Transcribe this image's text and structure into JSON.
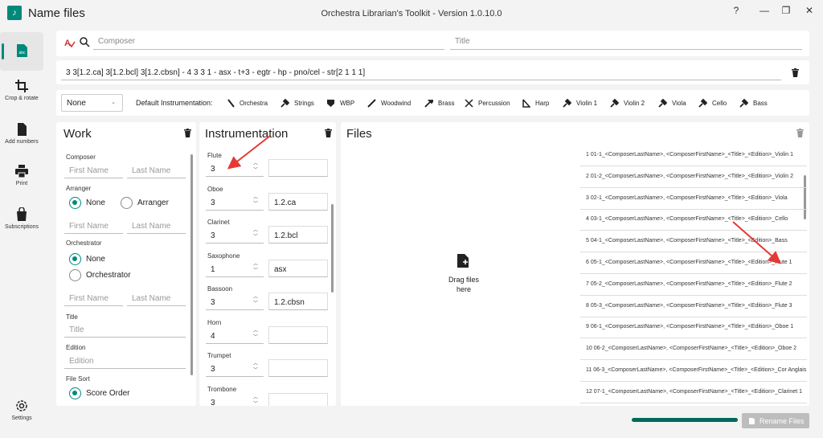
{
  "app": {
    "title": "Name files",
    "window_title": "Orchestra Librarian's Toolkit - Version 1.0.10.0",
    "controls": [
      "?",
      "—",
      "❐",
      "✕"
    ]
  },
  "sidebar": {
    "items": [
      {
        "label": "",
        "icon": "abc-icon"
      },
      {
        "label": "Crop & rotate",
        "icon": "crop-icon"
      },
      {
        "label": "Add numbers",
        "icon": "document-icon"
      },
      {
        "label": "Print",
        "icon": "printer-icon"
      },
      {
        "label": "Subscriptions",
        "icon": "bag-icon"
      }
    ],
    "settings_label": "Settings",
    "abc_text": "abc"
  },
  "search": {
    "composer_placeholder": "Composer",
    "title_placeholder": "Title"
  },
  "instr_string": "3 3[1.2.ca] 3[1.2.bcl] 3[1.2.cbsn] - 4 3 3 1 - asx - t+3 - egtr - hp - pno/cel - str[2 1 1 1]",
  "default_bar": {
    "dropdown": "None",
    "label": "Default Instrumentation:",
    "items": [
      "Orchestra",
      "Strings",
      "WBP",
      "Woodwind",
      "Brass",
      "Percussion",
      "Harp",
      "Violin 1",
      "Violin 2",
      "Viola",
      "Cello",
      "Bass"
    ]
  },
  "work": {
    "heading": "Work",
    "composer": "Composer",
    "first": "First Name",
    "last": "Last Name",
    "arranger": "Arranger",
    "none": "None",
    "arranger_opt": "Arranger",
    "orchestrator": "Orchestrator",
    "orch_opt": "Orchestrator",
    "title_label": "Title",
    "title_ph": "Title",
    "edition_label": "Edition",
    "edition_ph": "Edition",
    "file_sort": "File Sort",
    "score_order": "Score Order"
  },
  "instrumentation": {
    "heading": "Instrumentation",
    "rows": [
      {
        "name": "Flute",
        "count": "3",
        "extra": ""
      },
      {
        "name": "Oboe",
        "count": "3",
        "extra": "1.2.ca"
      },
      {
        "name": "Clarinet",
        "count": "3",
        "extra": "1.2.bcl"
      },
      {
        "name": "Saxophone",
        "count": "1",
        "extra": "asx"
      },
      {
        "name": "Bassoon",
        "count": "3",
        "extra": "1.2.cbsn"
      },
      {
        "name": "Horn",
        "count": "4",
        "extra": ""
      },
      {
        "name": "Trumpet",
        "count": "3",
        "extra": ""
      },
      {
        "name": "Trombone",
        "count": "3",
        "extra": ""
      }
    ]
  },
  "files": {
    "heading": "Files",
    "drag_line1": "Drag files",
    "drag_line2": "here",
    "list": [
      "1 01-1_<ComposerLastName>, <ComposerFirstName>_<Title>_<Edition>_Violin 1",
      "2 01-2_<ComposerLastName>, <ComposerFirstName>_<Title>_<Edition>_Violin 2",
      "3 02-1_<ComposerLastName>, <ComposerFirstName>_<Title>_<Edition>_Viola",
      "4 03-1_<ComposerLastName>, <ComposerFirstName>_<Title>_<Edition>_Cello",
      "5 04-1_<ComposerLastName>, <ComposerFirstName>_<Title>_<Edition>_Bass",
      "6 05-1_<ComposerLastName>, <ComposerFirstName>_<Title>_<Edition>_Flute 1",
      "7 05-2_<ComposerLastName>, <ComposerFirstName>_<Title>_<Edition>_Flute 2",
      "8 05-3_<ComposerLastName>, <ComposerFirstName>_<Title>_<Edition>_Flute 3",
      "9 06-1_<ComposerLastName>, <ComposerFirstName>_<Title>_<Edition>_Oboe 1",
      "10 06-2_<ComposerLastName>, <ComposerFirstName>_<Title>_<Edition>_Oboe 2",
      "11 06-3_<ComposerLastName>, <ComposerFirstName>_<Title>_<Edition>_Cor Anglais",
      "12 07-1_<ComposerLastName>, <ComposerFirstName>_<Title>_<Edition>_Clarinet 1"
    ]
  },
  "footer": {
    "rename_label": "Rename Files",
    "progress": 1.0
  },
  "colors": {
    "accent": "#00897b",
    "annotation": "#e53935"
  }
}
